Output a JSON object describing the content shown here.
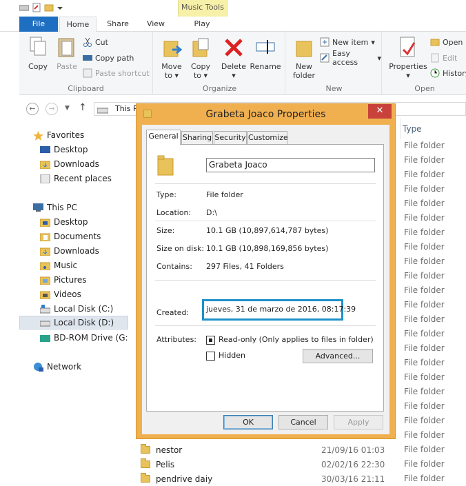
{
  "ribbon_tabs": {
    "file": "File",
    "home": "Home",
    "share": "Share",
    "view": "View",
    "context_group": "Music Tools",
    "play": "Play"
  },
  "clipboard": {
    "copy": "Copy",
    "paste": "Paste",
    "cut": "Cut",
    "copy_path": "Copy path",
    "paste_shortcut": "Paste shortcut",
    "label": "Clipboard"
  },
  "organize": {
    "move_to_1": "Move",
    "move_to_2": "to",
    "copy_to_1": "Copy",
    "copy_to_2": "to",
    "delete": "Delete",
    "rename": "Rename",
    "label": "Organize"
  },
  "new": {
    "new_folder_1": "New",
    "new_folder_2": "folder",
    "new_item": "New item",
    "easy_access": "Easy access",
    "label": "New"
  },
  "open": {
    "properties": "Properties",
    "open": "Open",
    "edit": "Edit",
    "history": "History",
    "label": "Open"
  },
  "address": {
    "path": "This PC"
  },
  "tree": {
    "favorites": "Favorites",
    "desktop": "Desktop",
    "downloads": "Downloads",
    "recent": "Recent places",
    "thispc": "This PC",
    "pc_desktop": "Desktop",
    "documents": "Documents",
    "pc_downloads": "Downloads",
    "music": "Music",
    "pictures": "Pictures",
    "videos": "Videos",
    "local_c": "Local Disk (C:)",
    "local_d": "Local Disk (D:)",
    "bdrom": "BD-ROM Drive (G:) I",
    "network": "Network"
  },
  "list": {
    "type_header": "Type",
    "file_folder": "File folder",
    "rows": [
      {
        "name": "nestor",
        "date": "21/09/16 01:03",
        "type": "File folder"
      },
      {
        "name": "Pelis",
        "date": "02/02/16 22:30",
        "type": "File folder"
      },
      {
        "name": "pendrive daiy",
        "date": "30/03/16 21:11",
        "type": "File folder"
      }
    ]
  },
  "dialog": {
    "title": "Grabeta Joaco Properties",
    "close": "✕",
    "tabs": {
      "general": "General",
      "sharing": "Sharing",
      "security": "Security",
      "customize": "Customize"
    },
    "name_value": "Grabeta Joaco",
    "labels": {
      "type": "Type:",
      "location": "Location:",
      "size": "Size:",
      "size_on_disk": "Size on disk:",
      "contains": "Contains:",
      "created": "Created:",
      "attributes": "Attributes:"
    },
    "values": {
      "type": "File folder",
      "location": "D:\\",
      "size": "10.1 GB (10,897,614,787 bytes)",
      "size_on_disk": "10.1 GB (10,898,169,856 bytes)",
      "contains": "297 Files, 41 Folders",
      "created": "jueves, 31 de marzo de 2016, 08:17:39"
    },
    "readonly": "Read-only (Only applies to files in folder)",
    "hidden": "Hidden",
    "advanced": "Advanced...",
    "ok": "OK",
    "cancel": "Cancel",
    "apply": "Apply"
  }
}
